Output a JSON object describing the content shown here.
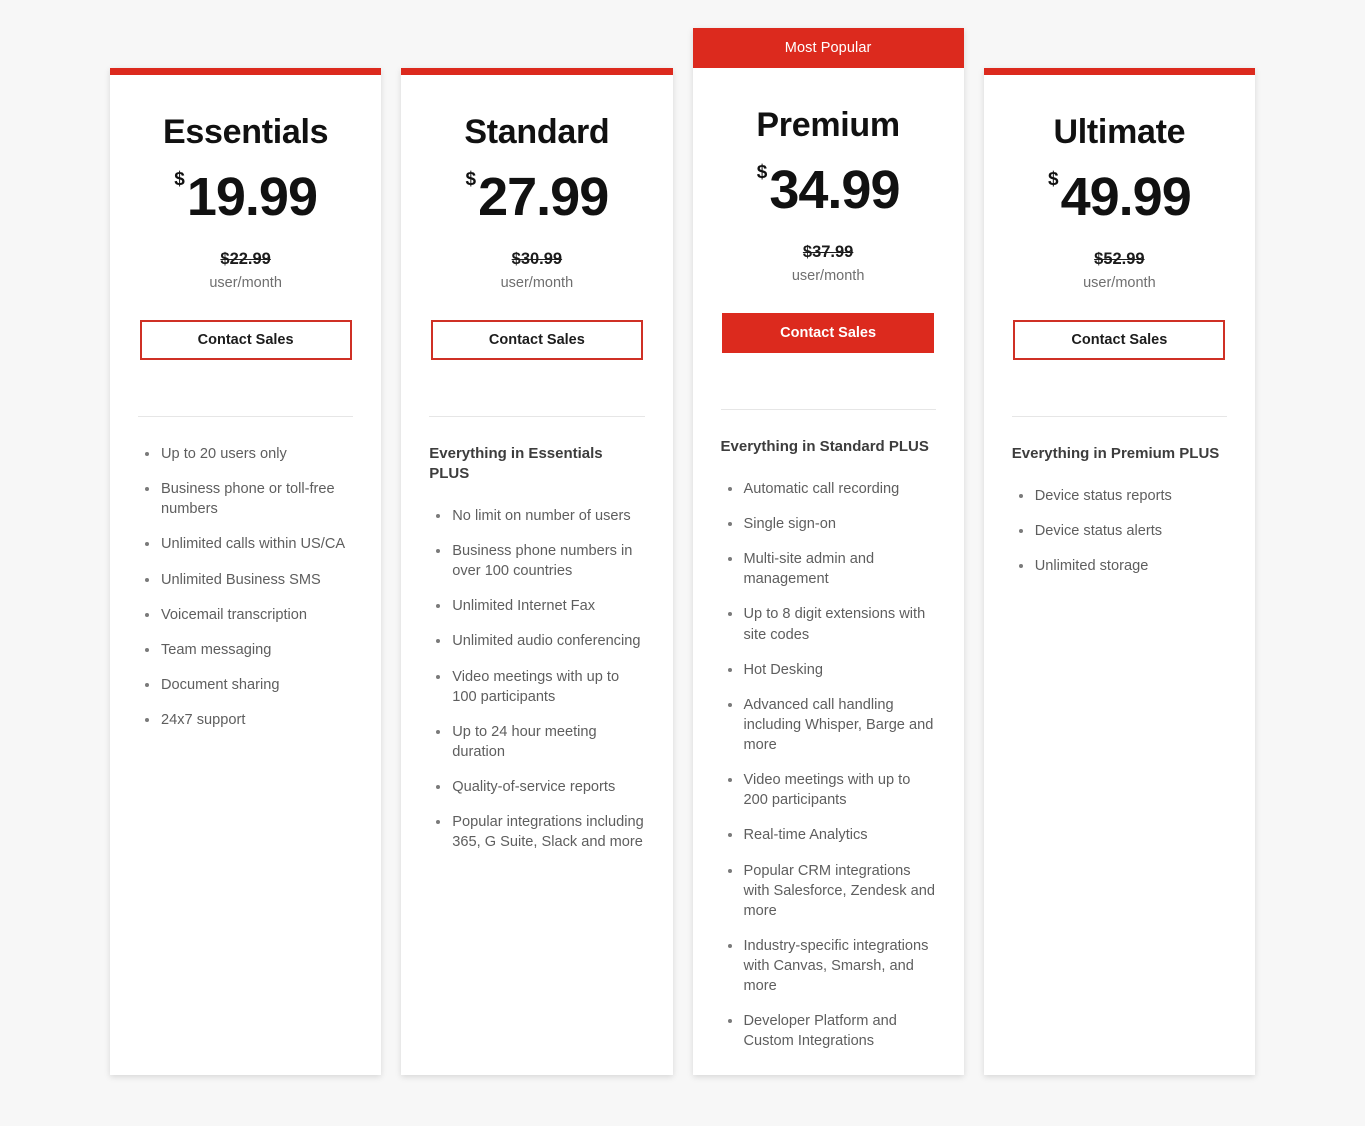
{
  "page": {
    "background": "#f7f7f7",
    "accent_color": "#dc2a1e"
  },
  "plans": [
    {
      "id": "essentials",
      "name": "Essentials",
      "currency": "$",
      "price": "19.99",
      "old_price": "$22.99",
      "per_unit": "user/month",
      "cta_label": "Contact Sales",
      "featured": false,
      "badge": "",
      "features_heading": "",
      "features": [
        "Up to 20 users only",
        "Business phone or toll-free numbers",
        "Unlimited calls within US/CA",
        "Unlimited Business SMS",
        "Voicemail transcription",
        "Team messaging",
        "Document sharing",
        "24x7 support"
      ]
    },
    {
      "id": "standard",
      "name": "Standard",
      "currency": "$",
      "price": "27.99",
      "old_price": "$30.99",
      "per_unit": "user/month",
      "cta_label": "Contact Sales",
      "featured": false,
      "badge": "",
      "features_heading": "Everything in Essentials PLUS",
      "features": [
        "No limit on number of users",
        "Business phone numbers in over 100 countries",
        "Unlimited Internet Fax",
        "Unlimited audio conferencing",
        "Video meetings with up to 100 participants",
        "Up to 24 hour meeting duration",
        "Quality-of-service reports",
        "Popular integrations including 365, G Suite, Slack and more"
      ]
    },
    {
      "id": "premium",
      "name": "Premium",
      "currency": "$",
      "price": "34.99",
      "old_price": "$37.99",
      "per_unit": "user/month",
      "cta_label": "Contact Sales",
      "featured": true,
      "badge": "Most Popular",
      "features_heading": "Everything in Standard PLUS",
      "features": [
        "Automatic call recording",
        "Single sign-on",
        "Multi-site admin and management",
        "Up to 8 digit extensions with site codes",
        "Hot Desking",
        "Advanced call handling including Whisper, Barge and more",
        "Video meetings with up to 200 participants",
        "Real-time Analytics",
        "Popular CRM integrations with Salesforce, Zendesk and more",
        "Industry-specific integrations with Canvas, Smarsh, and more",
        "Developer Platform and Custom Integrations"
      ]
    },
    {
      "id": "ultimate",
      "name": "Ultimate",
      "currency": "$",
      "price": "49.99",
      "old_price": "$52.99",
      "per_unit": "user/month",
      "cta_label": "Contact Sales",
      "featured": false,
      "badge": "",
      "features_heading": "Everything in Premium PLUS",
      "features": [
        "Device status reports",
        "Device status alerts",
        "Unlimited storage"
      ]
    }
  ]
}
